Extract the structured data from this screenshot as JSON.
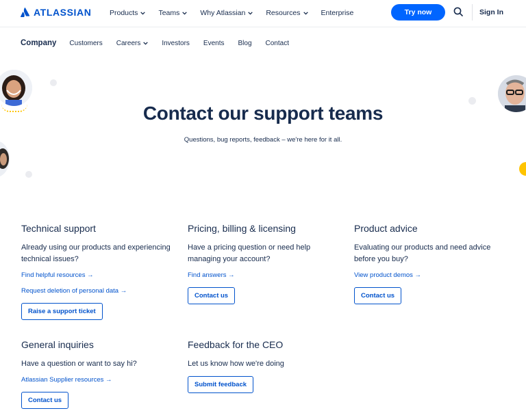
{
  "brand": {
    "name": "ATLASSIAN",
    "color": "#0052cc"
  },
  "topnav": {
    "menu": [
      {
        "label": "Products",
        "dropdown": true
      },
      {
        "label": "Teams",
        "dropdown": true
      },
      {
        "label": "Why Atlassian",
        "dropdown": true
      },
      {
        "label": "Resources",
        "dropdown": true
      },
      {
        "label": "Enterprise",
        "dropdown": false
      }
    ],
    "try_label": "Try now",
    "signin_label": "Sign In",
    "icons": {
      "search": "search-icon"
    }
  },
  "subnav": {
    "title": "Company",
    "items": [
      {
        "label": "Customers",
        "dropdown": false
      },
      {
        "label": "Careers",
        "dropdown": true
      },
      {
        "label": "Investors",
        "dropdown": false
      },
      {
        "label": "Events",
        "dropdown": false
      },
      {
        "label": "Blog",
        "dropdown": false
      },
      {
        "label": "Contact",
        "dropdown": false
      }
    ]
  },
  "hero": {
    "title": "Contact our support teams",
    "subtitle": "Questions, bug reports, feedback – we're here for it all."
  },
  "cards": {
    "technical": {
      "title": "Technical support",
      "desc": "Already using our products and experiencing technical issues?",
      "link1": "Find helpful resources →",
      "link2": "Request deletion of personal data →",
      "button": "Raise a support ticket"
    },
    "pricing": {
      "title": "Pricing, billing & licensing",
      "desc": "Have a pricing question or need help managing your account?",
      "link1": "Find answers →",
      "button": "Contact us"
    },
    "product": {
      "title": "Product advice",
      "desc": "Evaluating our products and need advice before you buy?",
      "link1": "View product demos →",
      "button": "Contact us"
    },
    "general": {
      "title": "General inquiries",
      "desc": "Have a question or want to say hi?",
      "link1": "Atlassian Supplier resources →",
      "button": "Contact us"
    },
    "ceo": {
      "title": "Feedback for the CEO",
      "desc": "Let us know how we're doing",
      "button": "Submit feedback"
    }
  },
  "colors": {
    "primary": "#0065ff",
    "link": "#0052cc",
    "text": "#172b4d",
    "accent_yellow": "#ffc400",
    "dot_gray": "#dfe1e6"
  }
}
